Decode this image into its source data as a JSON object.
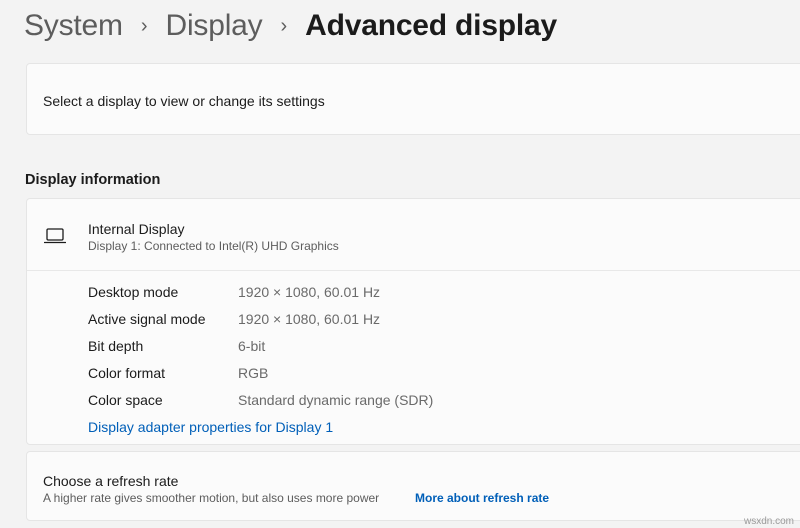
{
  "breadcrumb": {
    "items": [
      "System",
      "Display",
      "Advanced display"
    ],
    "separator": "›"
  },
  "select_display": {
    "text": "Select a display to view or change its settings"
  },
  "display_information": {
    "section_title": "Display information",
    "display_name": "Internal Display",
    "display_subtitle": "Display 1: Connected to Intel(R) UHD Graphics",
    "icon": "laptop-icon",
    "properties": [
      {
        "label": "Desktop mode",
        "value": "1920 × 1080, 60.01 Hz"
      },
      {
        "label": "Active signal mode",
        "value": "1920 × 1080, 60.01 Hz"
      },
      {
        "label": "Bit depth",
        "value": "6-bit"
      },
      {
        "label": "Color format",
        "value": "RGB"
      },
      {
        "label": "Color space",
        "value": "Standard dynamic range (SDR)"
      }
    ],
    "adapter_link": "Display adapter properties for Display 1"
  },
  "refresh_rate": {
    "title": "Choose a refresh rate",
    "description": "A higher rate gives smoother motion, but also uses more power",
    "link": "More about refresh rate"
  },
  "watermark": "wsxdn.com",
  "colors": {
    "background": "#f3f3f3",
    "card": "#fbfbfb",
    "link": "#005fb8"
  }
}
